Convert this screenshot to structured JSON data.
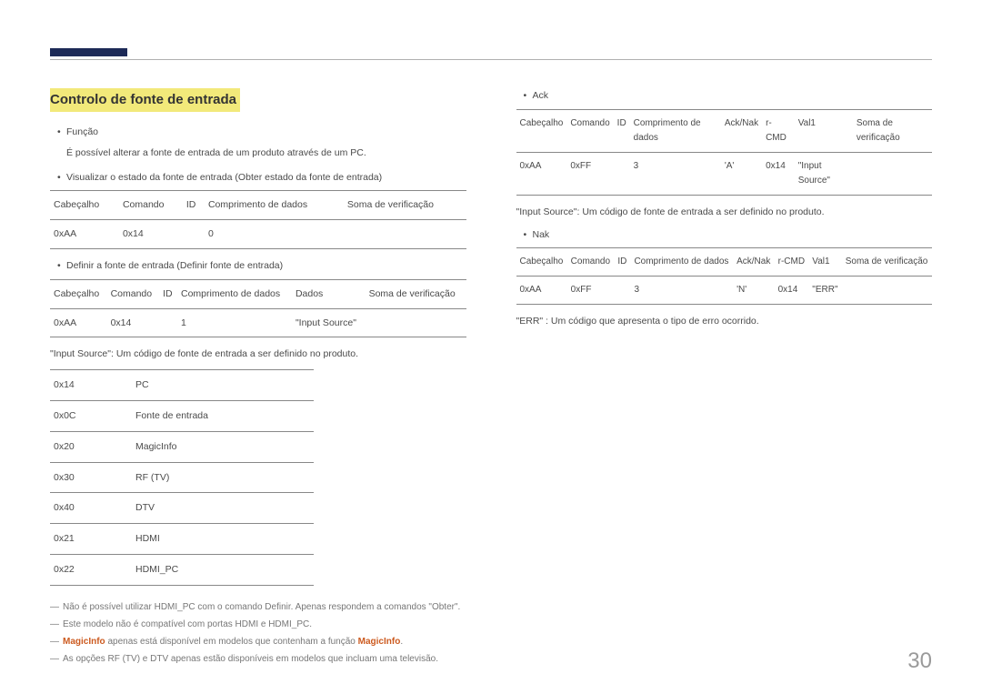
{
  "page_number": "30",
  "left": {
    "heading": "Controlo de fonte de entrada",
    "func_label": "Função",
    "func_desc": "É possível alterar a fonte de entrada de um produto através de um PC.",
    "view_state": "Visualizar o estado da fonte de entrada (Obter estado da fonte de entrada)",
    "tbl1_h": [
      "Cabeçalho",
      "Comando",
      "ID",
      "Comprimento de dados",
      "Soma de verificação"
    ],
    "tbl1_r": [
      "0xAA",
      "0x14",
      "",
      "0",
      ""
    ],
    "set_source": "Definir a fonte de entrada (Definir fonte de entrada)",
    "tbl2_h": [
      "Cabeçalho",
      "Comando",
      "ID",
      "Comprimento de dados",
      "Dados",
      "Soma de verificação"
    ],
    "tbl2_r": [
      "0xAA",
      "0x14",
      "",
      "1",
      "\"Input Source\"",
      ""
    ],
    "input_src_desc": "\"Input Source\": Um código de fonte de entrada a ser definido no produto.",
    "codes": [
      [
        "0x14",
        "PC"
      ],
      [
        "0x0C",
        "Fonte de entrada"
      ],
      [
        "0x20",
        "MagicInfo"
      ],
      [
        "0x30",
        "RF (TV)"
      ],
      [
        "0x40",
        "DTV"
      ],
      [
        "0x21",
        "HDMI"
      ],
      [
        "0x22",
        "HDMI_PC"
      ]
    ],
    "note1": "Não é possível utilizar HDMI_PC com o comando Definir. Apenas respondem a comandos \"Obter\".",
    "note2": "Este modelo não é compatível com portas HDMI e HDMI_PC.",
    "note3a": "MagicInfo",
    "note3b": " apenas está disponível em modelos que contenham a função ",
    "note3c": "MagicInfo",
    "note3d": ".",
    "note4": "As opções RF (TV) e DTV apenas estão disponíveis em modelos que incluam uma televisão."
  },
  "right": {
    "ack": "Ack",
    "tblA_h": [
      "Cabeçalho",
      "Comando",
      "ID",
      "Comprimento de dados",
      "Ack/Nak",
      "r-CMD",
      "Val1",
      "Soma de verificação"
    ],
    "tblA_r": [
      "0xAA",
      "0xFF",
      "",
      "3",
      "'A'",
      "0x14",
      "\"Input Source\"",
      ""
    ],
    "ack_desc": "\"Input Source\": Um código de fonte de entrada a ser definido no produto.",
    "nak": "Nak",
    "tblN_h": [
      "Cabeçalho",
      "Comando",
      "ID",
      "Comprimento de dados",
      "Ack/Nak",
      "r-CMD",
      "Val1",
      "Soma de verificação"
    ],
    "tblN_r": [
      "0xAA",
      "0xFF",
      "",
      "3",
      "'N'",
      "0x14",
      "\"ERR\"",
      ""
    ],
    "err_desc": "\"ERR\" : Um código que apresenta o tipo de erro ocorrido."
  }
}
